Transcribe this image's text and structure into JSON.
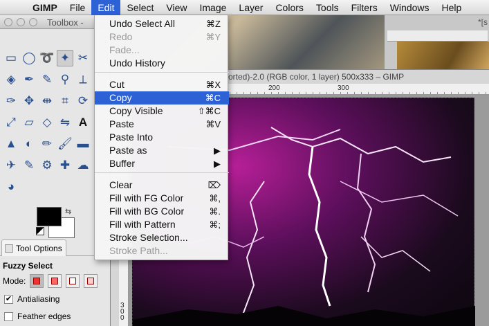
{
  "menubar": {
    "apple_icon": "apple-logo-icon",
    "items": [
      "GIMP",
      "File",
      "Edit",
      "Select",
      "View",
      "Image",
      "Layer",
      "Colors",
      "Tools",
      "Filters",
      "Windows",
      "Help"
    ],
    "active": "Edit"
  },
  "toolbox": {
    "title": "Toolbox -",
    "tools": [
      "rect-select-icon",
      "ellipse-select-icon",
      "free-select-icon",
      "fuzzy-select-icon",
      "scissors-icon",
      "color-select-icon",
      "paths-icon",
      "color-picker-icon",
      "zoom-icon",
      "measure-icon",
      "pen-icon",
      "move-icon",
      "align-icon",
      "crop-icon",
      "rotate-icon",
      "scale-icon",
      "shear-icon",
      "perspective-icon",
      "flip-icon",
      "text-icon",
      "bucket-icon",
      "blend-icon",
      "pencil-icon",
      "paintbrush-icon",
      "eraser-icon",
      "airbrush-icon",
      "ink-icon",
      "clone-icon",
      "heal-icon",
      "smudge-icon",
      "dodge-icon"
    ],
    "fg_color": "#000000",
    "bg_color": "#ffffff"
  },
  "tool_options": {
    "tab_label": "Tool Options",
    "title": "Fuzzy Select",
    "mode_label": "Mode:",
    "antialiasing_label": "Antialiasing",
    "antialiasing_checked": true,
    "feather_label": "Feather edges",
    "feather_checked": false
  },
  "right_window": {
    "title": "*[s"
  },
  "image_window": {
    "title": "orted)-2.0 (RGB color, 1 layer) 500x333 – GIMP",
    "ruler_h": [
      "200",
      "300"
    ],
    "ruler_v": [
      "3",
      "0",
      "0"
    ]
  },
  "edit_menu": {
    "items": [
      {
        "label": "Undo Select All",
        "shortcut": "⌘Z",
        "enabled": true
      },
      {
        "label": "Redo",
        "shortcut": "⌘Y",
        "enabled": false
      },
      {
        "label": "Fade...",
        "shortcut": "",
        "enabled": false
      },
      {
        "label": "Undo History",
        "shortcut": "",
        "enabled": true
      },
      {
        "label": "Cut",
        "shortcut": "⌘X",
        "enabled": true
      },
      {
        "label": "Copy",
        "shortcut": "⌘C",
        "enabled": true,
        "highlighted": true
      },
      {
        "label": "Copy Visible",
        "shortcut": "⇧⌘C",
        "enabled": true
      },
      {
        "label": "Paste",
        "shortcut": "⌘V",
        "enabled": true
      },
      {
        "label": "Paste Into",
        "shortcut": "",
        "enabled": true
      },
      {
        "label": "Paste as",
        "shortcut": "▶",
        "enabled": true
      },
      {
        "label": "Buffer",
        "shortcut": "▶",
        "enabled": true
      },
      {
        "label": "Clear",
        "shortcut": "⌦",
        "enabled": true
      },
      {
        "label": "Fill with FG Color",
        "shortcut": "⌘,",
        "enabled": true
      },
      {
        "label": "Fill with BG Color",
        "shortcut": "⌘.",
        "enabled": true
      },
      {
        "label": "Fill with Pattern",
        "shortcut": "⌘;",
        "enabled": true
      },
      {
        "label": "Stroke Selection...",
        "shortcut": "",
        "enabled": true
      },
      {
        "label": "Stroke Path...",
        "shortcut": "",
        "enabled": false
      }
    ]
  }
}
